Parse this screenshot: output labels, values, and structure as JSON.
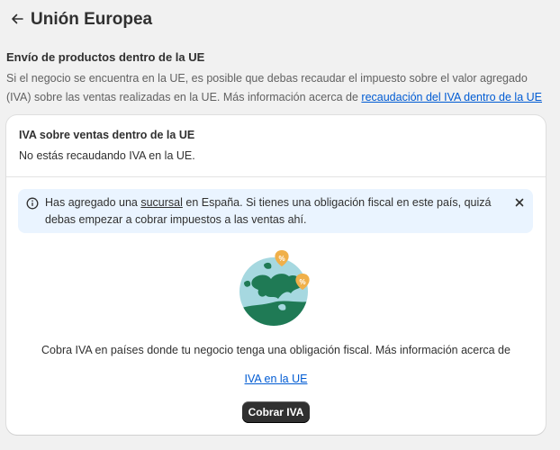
{
  "header": {
    "title": "Unión Europea",
    "back_icon": "arrow-left-icon"
  },
  "section": {
    "title": "Envío de productos dentro de la UE",
    "description": "Si el negocio se encuentra en la UE, es posible que debas recaudar el impuesto sobre el valor agregado (IVA) sobre las ventas realizadas en la UE. Más información acerca de ",
    "link": "recaudación del IVA dentro de la UE"
  },
  "card": {
    "title": "IVA sobre ventas dentro de la UE",
    "status": "No estás recaudando IVA en la UE.",
    "banner": {
      "icon": "info-circle-icon",
      "text_before": "Has agregado una ",
      "link": "sucursal",
      "text_after": " en España. Si tienes una obligación fiscal en este país, quizá debas empezar a cobrar impuestos a las ventas ahí.",
      "close_icon": "close-icon"
    },
    "empty_state": {
      "illustration": "europe-map-tax-illustration",
      "text": "Cobra IVA en países donde tu negocio tenga una obligación fiscal. Más información acerca de",
      "link": "IVA en la UE",
      "button": "Cobrar IVA"
    }
  },
  "colors": {
    "page_bg": "#f1f1f1",
    "link": "#005bd3",
    "banner_bg": "#eaf4ff",
    "primary_button": "#303030",
    "map_green": "#1f7a55",
    "map_water": "#a6d8e0",
    "pin_orange": "#f0b04a"
  }
}
